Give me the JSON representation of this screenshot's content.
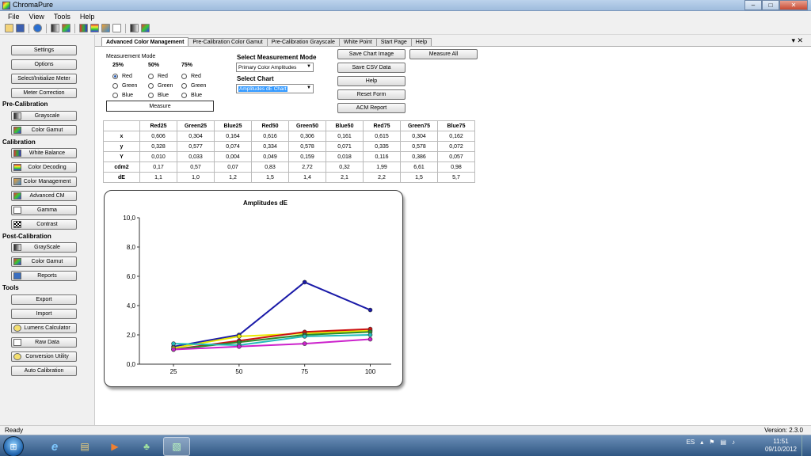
{
  "window": {
    "title": "ChromaPure",
    "controls": [
      "–",
      "□",
      "✕"
    ]
  },
  "menu": [
    "File",
    "View",
    "Tools",
    "Help"
  ],
  "sidebar": {
    "settings": "Settings",
    "options": "Options",
    "select_meter": "Select/Initialize Meter",
    "meter_correction": "Meter Correction",
    "pre_calibration": "Pre-Calibration",
    "pre_grayscale": "Grayscale",
    "pre_color_gamut": "Color Gamut",
    "calibration": "Calibration",
    "white_balance": "White Balance",
    "color_decoding": "Color Decoding",
    "color_management": "Color Management",
    "advanced_cm": "Advanced CM",
    "gamma": "Gamma",
    "contrast": "Contrast",
    "post_calibration": "Post-Calibration",
    "post_grayscale": "GrayScale",
    "post_color_gamut": "Color Gamut",
    "reports": "Reports",
    "tools": "Tools",
    "export": "Export",
    "import": "Import",
    "lumens_calculator": "Lumens Calculator",
    "raw_data": "Raw Data",
    "conversion_utility": "Conversion Utility",
    "auto_calibration": "Auto Calibration"
  },
  "tabs": [
    "Advanced Color Management",
    "Pre-Calibration Color Gamut",
    "Pre-Calibration Grayscale",
    "White Point",
    "Start Page",
    "Help"
  ],
  "tab_controls": "▾ ✕",
  "measurement": {
    "title": "Measurement Mode",
    "columns": [
      {
        "head": "25%",
        "options": [
          "Red",
          "Green",
          "Blue"
        ]
      },
      {
        "head": "50%",
        "options": [
          "Red",
          "Green",
          "Blue"
        ]
      },
      {
        "head": "75%",
        "options": [
          "Red",
          "Green",
          "Blue"
        ]
      }
    ],
    "measure_button": "Measure"
  },
  "select_mode": {
    "label": "Select Measurement Mode",
    "value": "Primary Color Amplitudes"
  },
  "select_chart": {
    "label": "Select Chart",
    "value": "Amplitudes dE Chart"
  },
  "actions": {
    "save_chart": "Save Chart Image",
    "measure_all": "Measure All",
    "save_csv": "Save CSV Data",
    "help": "Help",
    "reset": "Reset Form",
    "acm_report": "ACM Report"
  },
  "table": {
    "headers": [
      "",
      "Red25",
      "Green25",
      "Blue25",
      "Red50",
      "Green50",
      "Blue50",
      "Red75",
      "Green75",
      "Blue75"
    ],
    "rows": [
      [
        "x",
        "0,606",
        "0,304",
        "0,164",
        "0,616",
        "0,306",
        "0,161",
        "0,615",
        "0,304",
        "0,162"
      ],
      [
        "y",
        "0,328",
        "0,577",
        "0,074",
        "0,334",
        "0,578",
        "0,071",
        "0,335",
        "0,578",
        "0,072"
      ],
      [
        "Y",
        "0,010",
        "0,033",
        "0,004",
        "0,049",
        "0,159",
        "0,018",
        "0,116",
        "0,386",
        "0,057"
      ],
      [
        "cdm2",
        "0,17",
        "0,57",
        "0,07",
        "0,83",
        "2,72",
        "0,32",
        "1,99",
        "6,61",
        "0,98"
      ],
      [
        "dE",
        "1,1",
        "1,0",
        "1,2",
        "1,5",
        "1,4",
        "2,1",
        "2,2",
        "1,5",
        "5,7"
      ]
    ]
  },
  "chart_data": {
    "type": "line",
    "title": "Amplitudes dE",
    "x": [
      25,
      50,
      75,
      100
    ],
    "xlabels": [
      "25",
      "50",
      "75",
      "100"
    ],
    "ylim": [
      0,
      10
    ],
    "yticks": [
      "0,0",
      "2,0",
      "4,0",
      "6,0",
      "8,0",
      "10,0"
    ],
    "yvals": [
      0,
      2,
      4,
      6,
      8,
      10
    ],
    "grid": false,
    "series": [
      {
        "color": "#1a1aa8",
        "values": [
          1.2,
          2.0,
          5.6,
          3.7
        ]
      },
      {
        "color": "#e8e800",
        "values": [
          1.1,
          1.9,
          2.1,
          2.3
        ]
      },
      {
        "color": "#cc1111",
        "values": [
          1.0,
          1.6,
          2.2,
          2.4
        ]
      },
      {
        "color": "#2a8a2a",
        "values": [
          1.0,
          1.5,
          2.0,
          2.2
        ]
      },
      {
        "color": "#22bbbb",
        "values": [
          1.4,
          1.3,
          1.9,
          2.0
        ]
      },
      {
        "color": "#cc22cc",
        "values": [
          1.0,
          1.2,
          1.4,
          1.7
        ]
      }
    ]
  },
  "status": {
    "left": "Ready",
    "right": "Version: 2.3.0"
  },
  "taskbar": {
    "start": "⊞",
    "apps": [
      "e",
      "▤",
      "▶",
      "♣",
      "▧"
    ],
    "lang": "ES",
    "time": "11:51",
    "date": "09/10/2012"
  }
}
